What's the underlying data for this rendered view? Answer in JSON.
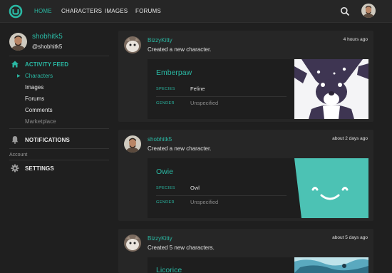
{
  "nav": {
    "links": [
      {
        "label": "HOME",
        "active": true
      },
      {
        "label": "CHARACTERS",
        "active": false
      },
      {
        "label": "IMAGES",
        "active": false
      },
      {
        "label": "FORUMS",
        "active": false
      }
    ],
    "search_icon": "search-icon",
    "accent": "#2ab8a3"
  },
  "sidebar": {
    "profile": {
      "name": "shobhitk5",
      "handle": "@shobhitk5"
    },
    "activity": {
      "label": "ACTIVITY FEED",
      "icon": "home-icon",
      "items": [
        {
          "label": "Characters",
          "active": true
        },
        {
          "label": "Images"
        },
        {
          "label": "Forums"
        },
        {
          "label": "Comments"
        },
        {
          "label": "Marketplace",
          "muted": true
        }
      ]
    },
    "notifications": {
      "label": "NOTIFICATIONS",
      "icon": "bell-icon"
    },
    "account_label": "Account",
    "settings": {
      "label": "SETTINGS",
      "icon": "gear-icon"
    }
  },
  "feed": [
    {
      "user": "BizzyKitty",
      "action": "Created a new character.",
      "time": "4 hours ago",
      "character": {
        "name": "Emberpaw",
        "species_key": "SPECIES",
        "species": "Feline",
        "gender_key": "GENDER",
        "gender": "Unspecified"
      }
    },
    {
      "user": "shobhitk5",
      "action": "Created a new character.",
      "time": "about 2 days ago",
      "character": {
        "name": "Owie",
        "species_key": "SPECIES",
        "species": "Owl",
        "gender_key": "GENDER",
        "gender": "Unspecified"
      }
    },
    {
      "user": "BizzyKitty",
      "action": "Created 5 new characters.",
      "time": "about 5 days ago",
      "character": {
        "name": "Licorice"
      }
    }
  ]
}
